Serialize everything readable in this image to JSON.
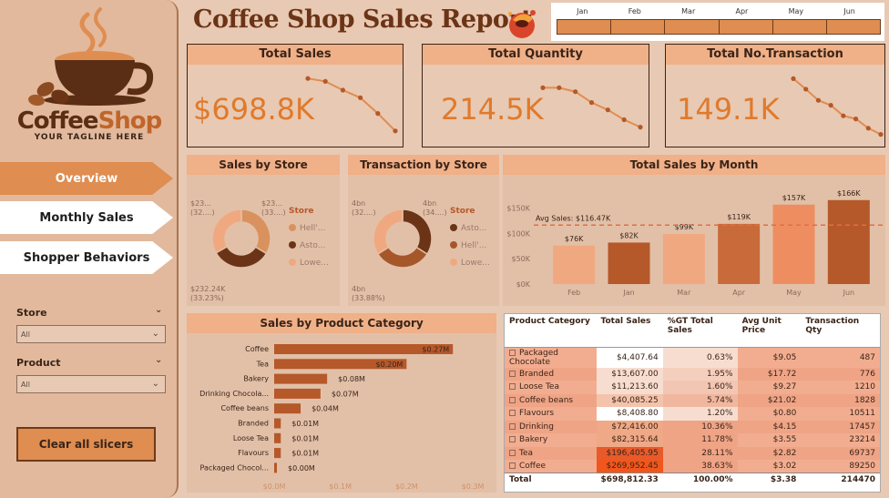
{
  "sidebar": {
    "logo_name_1": "Coffee",
    "logo_name_2": "Shop",
    "tagline": "YOUR TAGLINE HERE",
    "nav": [
      {
        "label": "Overview",
        "active": true
      },
      {
        "label": "Monthly Sales",
        "active": false
      },
      {
        "label": "Shopper Behaviors",
        "active": false
      }
    ],
    "store_label": "Store",
    "store_value": "All",
    "product_label": "Product",
    "product_value": "All",
    "clear_label": "Clear all slicers"
  },
  "header": {
    "title": "Coffee Shop Sales Report",
    "months": [
      "Jan",
      "Feb",
      "Mar",
      "Apr",
      "May",
      "Jun"
    ]
  },
  "kpis": [
    {
      "title": "Total Sales",
      "value": "$698.8K",
      "trend": [
        0.95,
        0.9,
        0.75,
        0.62,
        0.35,
        0.05
      ]
    },
    {
      "title": "Total Quantity",
      "value": "214.5K",
      "trend": [
        0.9,
        0.9,
        0.82,
        0.6,
        0.45,
        0.25,
        0.1
      ]
    },
    {
      "title": "Total No.Transaction",
      "value": "149.1K",
      "trend": [
        0.95,
        0.78,
        0.6,
        0.52,
        0.35,
        0.3,
        0.15,
        0.05
      ]
    }
  ],
  "colors": {
    "dark": "#6b3417",
    "mid": "#b5582a",
    "light": "#f0a880",
    "accent": "#df8d50",
    "bg": "#e8c9b3"
  },
  "sales_by_store": {
    "title": "Sales by Store",
    "legend_title": "Store",
    "legend": [
      "Hell'...",
      "Asto...",
      "Lowe..."
    ],
    "labels": [
      {
        "l1": "$23...",
        "l2": "(32....)"
      },
      {
        "l1": "$23...",
        "l2": "(33....)"
      },
      {
        "l1": "$232.24K",
        "l2": "(33.23%)"
      }
    ]
  },
  "transaction_by_store": {
    "title": "Transaction by Store",
    "legend_title": "Store",
    "legend": [
      "Asto...",
      "Hell'...",
      "Lowe..."
    ],
    "labels": [
      {
        "l1": "4bn",
        "l2": "(32....)"
      },
      {
        "l1": "4bn",
        "l2": "(34....)"
      },
      {
        "l1": "4bn",
        "l2": "(33.88%)"
      }
    ]
  },
  "chart_data": [
    {
      "type": "pie",
      "title": "Sales by Store",
      "categories": [
        "Hell'...",
        "Asto...",
        "Lowe..."
      ],
      "values": [
        33.6,
        33.2,
        33.2
      ]
    },
    {
      "type": "pie",
      "title": "Transaction by Store",
      "categories": [
        "Asto...",
        "Hell'...",
        "Lowe..."
      ],
      "values": [
        34.0,
        32.1,
        33.9
      ]
    },
    {
      "type": "bar",
      "title": "Total Sales by Month",
      "categories": [
        "Feb",
        "Jan",
        "Mar",
        "Apr",
        "May",
        "Jun"
      ],
      "values": [
        76,
        82,
        99,
        119,
        157,
        166
      ],
      "value_labels": [
        "$76K",
        "$82K",
        "$99K",
        "$119K",
        "$157K",
        "$166K"
      ],
      "yticks": [
        "$0K",
        "$50K",
        "$100K",
        "$150K"
      ],
      "ylim": [
        0,
        180
      ],
      "reference_line": {
        "label": "Avg Sales: $116.47K",
        "value": 116.47
      }
    },
    {
      "type": "bar",
      "orientation": "horizontal",
      "title": "Sales by Product Category",
      "categories": [
        "Coffee",
        "Tea",
        "Bakery",
        "Drinking Chocola...",
        "Coffee beans",
        "Branded",
        "Loose Tea",
        "Flavours",
        "Packaged Chocol..."
      ],
      "values": [
        0.27,
        0.2,
        0.08,
        0.07,
        0.04,
        0.01,
        0.01,
        0.01,
        0.0
      ],
      "value_labels": [
        "$0.27M",
        "$0.20M",
        "$0.08M",
        "$0.07M",
        "$0.04M",
        "$0.01M",
        "$0.01M",
        "$0.01M",
        "$0.00M"
      ],
      "xticks": [
        "$0.0M",
        "$0.1M",
        "$0.2M",
        "$0.3M"
      ],
      "xlim": [
        0,
        0.3
      ]
    }
  ],
  "table": {
    "headers": [
      "Product Category",
      "Total Sales",
      "%GT Total Sales",
      "Avg Unit Price",
      "Transaction Qty"
    ],
    "rows": [
      [
        "Packaged Chocolate",
        "$4,407.64",
        "0.63%",
        "$9.05",
        "487"
      ],
      [
        "Branded",
        "$13,607.00",
        "1.95%",
        "$17.72",
        "776"
      ],
      [
        "Loose Tea",
        "$11,213.60",
        "1.60%",
        "$9.27",
        "1210"
      ],
      [
        "Coffee beans",
        "$40,085.25",
        "5.74%",
        "$21.02",
        "1828"
      ],
      [
        "Flavours",
        "$8,408.80",
        "1.20%",
        "$0.80",
        "10511"
      ],
      [
        "Drinking",
        "$72,416.00",
        "10.36%",
        "$4.15",
        "17457"
      ],
      [
        "Bakery",
        "$82,315.64",
        "11.78%",
        "$3.55",
        "23214"
      ],
      [
        "Tea",
        "$196,405.95",
        "28.11%",
        "$2.82",
        "69737"
      ],
      [
        "Coffee",
        "$269,952.45",
        "38.63%",
        "$3.02",
        "89250"
      ]
    ],
    "total": [
      "Total",
      "$698,812.33",
      "100.00%",
      "$3.38",
      "214470"
    ]
  }
}
